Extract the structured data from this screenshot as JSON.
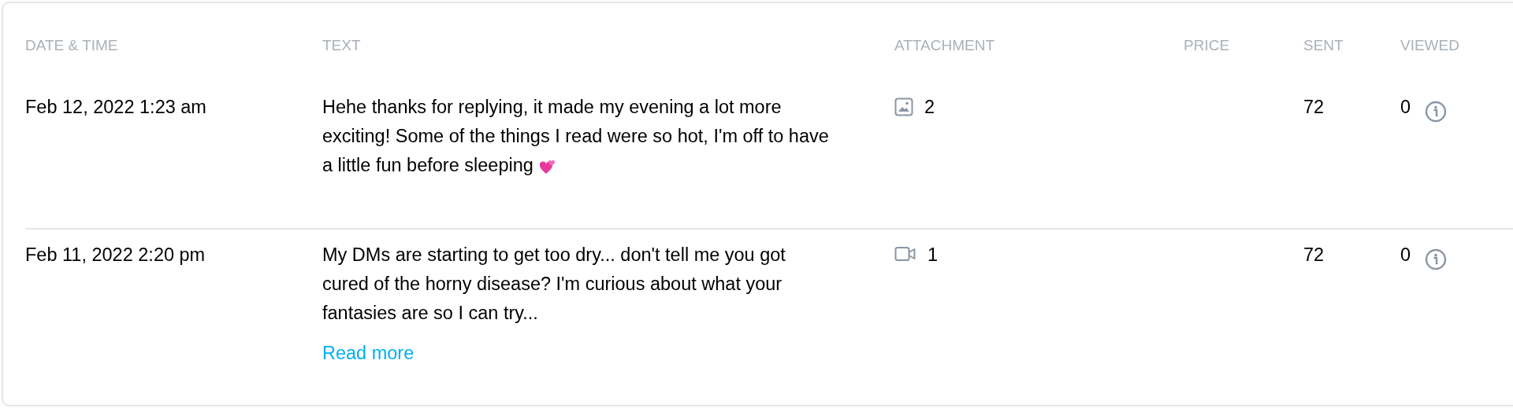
{
  "table": {
    "columns": [
      "DATE & TIME",
      "TEXT",
      "ATTACHMENT",
      "PRICE",
      "SENT",
      "VIEWED"
    ],
    "rows": [
      {
        "date_time": "Feb 12, 2022 1:23 am",
        "text": "Hehe thanks for replying, it made my evening a lot more exciting! Some of the things I read were so hot, I'm off to have a little fun before sleeping",
        "attachment": {
          "kind": "image",
          "count": "2"
        },
        "sent": "72",
        "viewed": "0"
      },
      {
        "date_time": "Feb 11, 2022 2:20 pm",
        "text": "My DMs are starting to get too dry... don't tell me you got cured of the horny disease? I'm curious about what your fantasies are so I can try...",
        "read_more": "Read more",
        "attachment": {
          "kind": "video",
          "count": "1"
        },
        "sent": "72",
        "viewed": "0"
      }
    ]
  }
}
